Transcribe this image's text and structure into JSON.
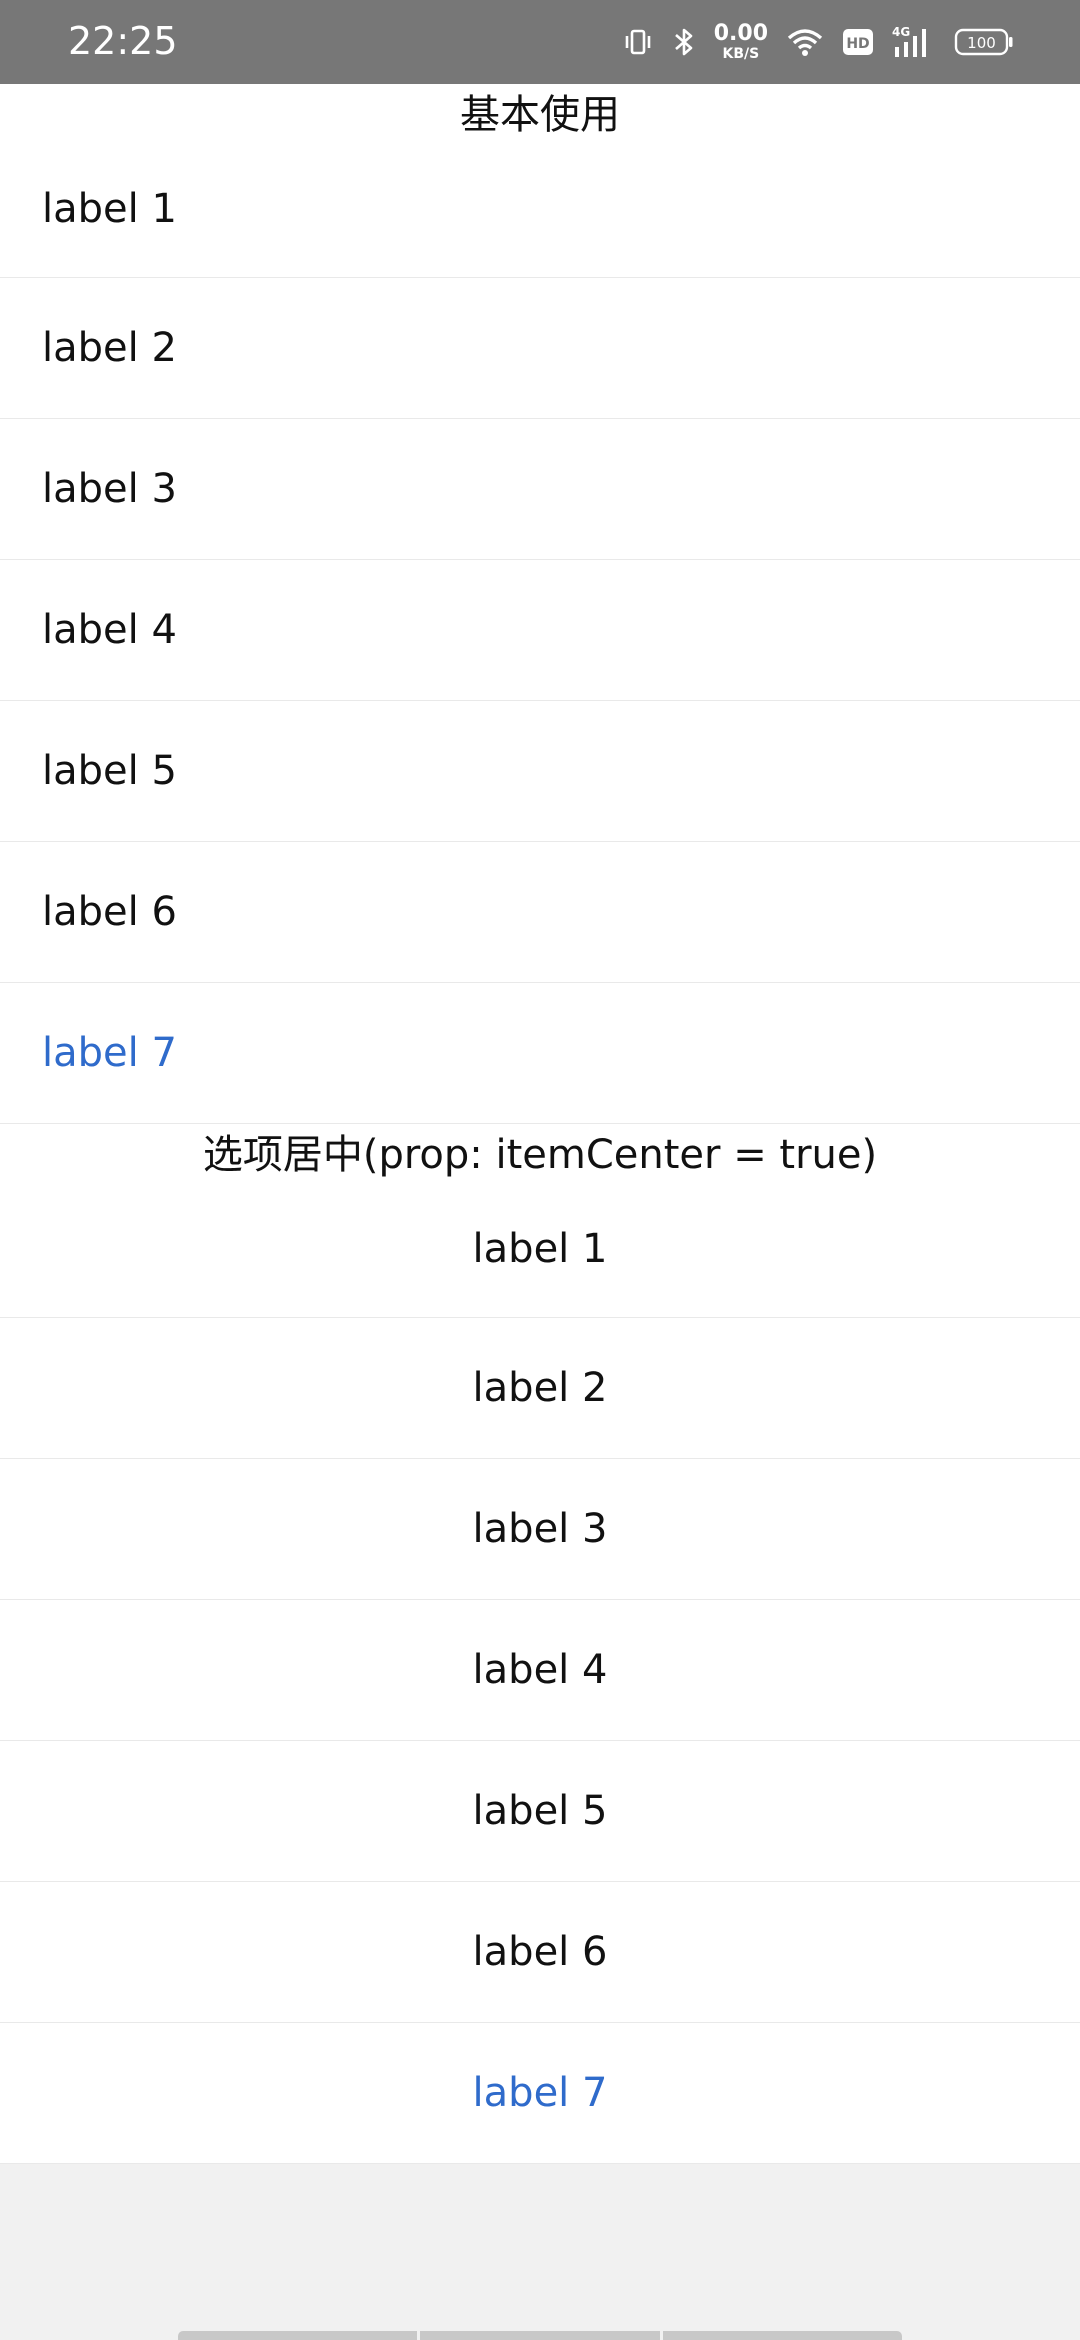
{
  "status_bar": {
    "time": "22:25",
    "net_speed_value": "0.00",
    "net_speed_unit": "KB/S",
    "hd_label": "HD",
    "network_label": "4G",
    "battery_level": "100"
  },
  "section1": {
    "title": "基本使用",
    "items": [
      "label 1",
      "label 2",
      "label 3",
      "label 4",
      "label 5",
      "label 6",
      "label 7"
    ]
  },
  "section2": {
    "title": "选项居中(prop: itemCenter = true)",
    "items": [
      "label 1",
      "label 2",
      "label 3",
      "label 4",
      "label 5",
      "label 6",
      "label 7"
    ]
  },
  "colors": {
    "status_bar_bg": "#777777",
    "active_item": "#2f6bcb",
    "divider": "#e9e9e9",
    "page_bg": "#f1f1f1"
  }
}
